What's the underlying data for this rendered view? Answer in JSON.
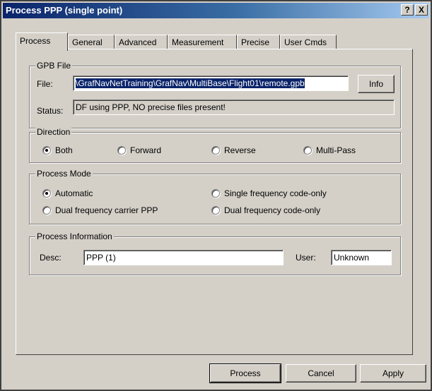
{
  "window": {
    "title": "Process PPP (single point)",
    "help_label": "?",
    "close_label": "X"
  },
  "tabs": [
    {
      "label": "Process",
      "active": true
    },
    {
      "label": "General"
    },
    {
      "label": "Advanced"
    },
    {
      "label": "Measurement"
    },
    {
      "label": "Precise"
    },
    {
      "label": "User Cmds"
    }
  ],
  "gpb": {
    "legend": "GPB File",
    "file_label": "File:",
    "file_value": "\\GrafNavNetTraining\\GrafNav\\MultiBase\\Flight01\\remote.gpb",
    "info_button": "Info",
    "status_label": "Status:",
    "status_value": "DF using PPP, NO precise files present!"
  },
  "direction": {
    "legend": "Direction",
    "options": [
      {
        "label": "Both",
        "selected": true
      },
      {
        "label": "Forward",
        "selected": false
      },
      {
        "label": "Reverse",
        "selected": false
      },
      {
        "label": "Multi-Pass",
        "selected": false
      }
    ]
  },
  "mode": {
    "legend": "Process Mode",
    "options": [
      {
        "label": "Automatic",
        "selected": true
      },
      {
        "label": "Single frequency code-only",
        "selected": false
      },
      {
        "label": "Dual frequency carrier PPP",
        "selected": false
      },
      {
        "label": "Dual frequency code-only",
        "selected": false
      }
    ]
  },
  "info": {
    "legend": "Process Information",
    "desc_label": "Desc:",
    "desc_value": "PPP (1)",
    "user_label": "User:",
    "user_value": "Unknown"
  },
  "buttons": {
    "process": "Process",
    "cancel": "Cancel",
    "apply": "Apply"
  }
}
